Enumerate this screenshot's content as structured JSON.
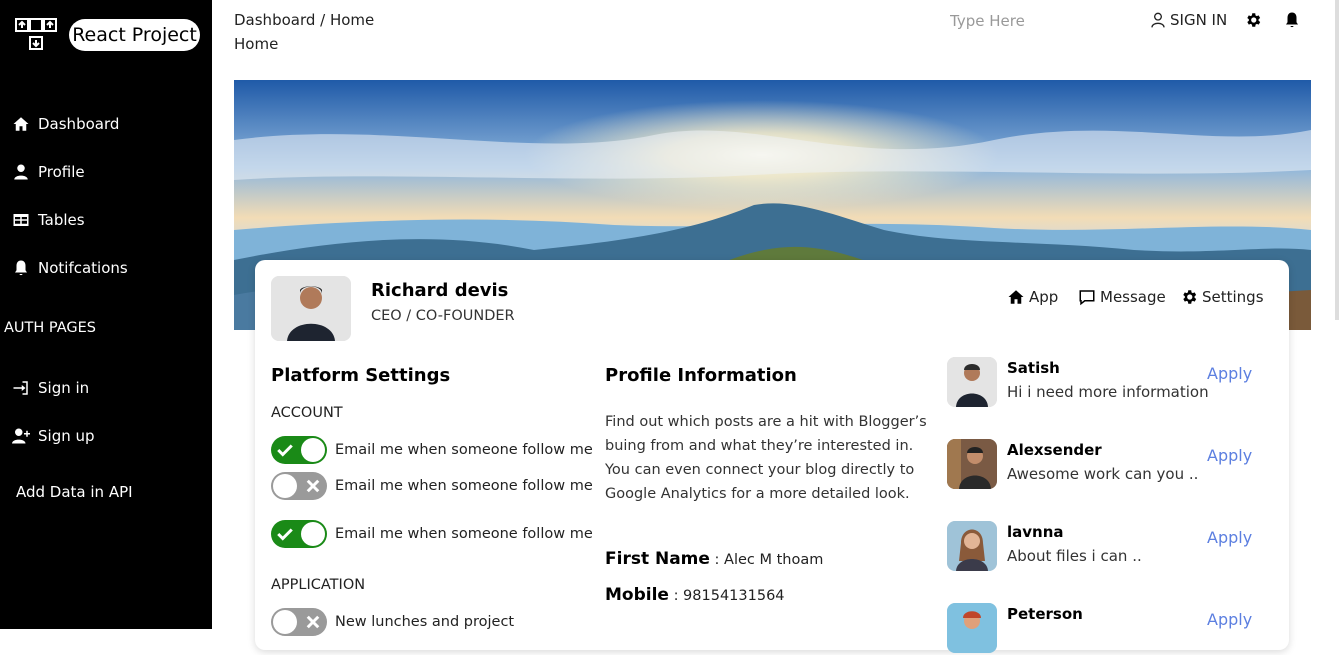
{
  "sidebar": {
    "brand": "React Project",
    "items": [
      {
        "label": "Dashboard",
        "icon": "home-icon"
      },
      {
        "label": "Profile",
        "icon": "user-icon"
      },
      {
        "label": "Tables",
        "icon": "table-icon"
      },
      {
        "label": "Notifcations",
        "icon": "bell-icon"
      }
    ],
    "auth_title": "AUTH PAGES",
    "auth_items": [
      {
        "label": "Sign in",
        "icon": "sign-in-icon"
      },
      {
        "label": "Sign up",
        "icon": "user-plus-icon"
      }
    ],
    "add_data": "Add Data in API"
  },
  "header": {
    "breadcrumb": "Dashboard / Home",
    "page_title": "Home",
    "search_placeholder": "Type Here",
    "signin_label": "SIGN IN"
  },
  "profile": {
    "name": "Richard devis",
    "role": "CEO / CO-FOUNDER",
    "tabs": [
      {
        "label": "App",
        "icon": "home-icon"
      },
      {
        "label": "Message",
        "icon": "message-icon"
      },
      {
        "label": "Settings",
        "icon": "gear-icon"
      }
    ]
  },
  "platform": {
    "title": "Platform Settings",
    "account_title": "ACCOUNT",
    "account_toggles": [
      {
        "label": "Email me when someone follow me",
        "on": true
      },
      {
        "label": "Email me when someone follow me",
        "on": false
      },
      {
        "label": "Email me when someone follow me",
        "on": true
      }
    ],
    "application_title": "APPLICATION",
    "application_toggles": [
      {
        "label": "New lunches and project",
        "on": false
      }
    ]
  },
  "info": {
    "title": "Profile Information",
    "about": "Find out which posts are a hit with Blogger’s buing from and what they’re interested in. You can even connect your blog directly to Google Analytics for a more detailed look.",
    "first_name_key": "First Name",
    "first_name_val": ": Alec M thoam",
    "mobile_key": "Mobile",
    "mobile_val": ": 98154131564"
  },
  "conversations": [
    {
      "name": "Satish",
      "msg": "Hi i need more information",
      "action": "Apply"
    },
    {
      "name": "Alexsender",
      "msg": "Awesome work can you ..",
      "action": "Apply"
    },
    {
      "name": "lavnna",
      "msg": "About files i can ..",
      "action": "Apply"
    },
    {
      "name": "Peterson",
      "msg": "",
      "action": "Apply"
    }
  ],
  "colors": {
    "sidebar_bg": "#000000",
    "toggle_on": "#1a8a17",
    "toggle_off": "#9a9a9a",
    "link": "#5c7fe0"
  }
}
